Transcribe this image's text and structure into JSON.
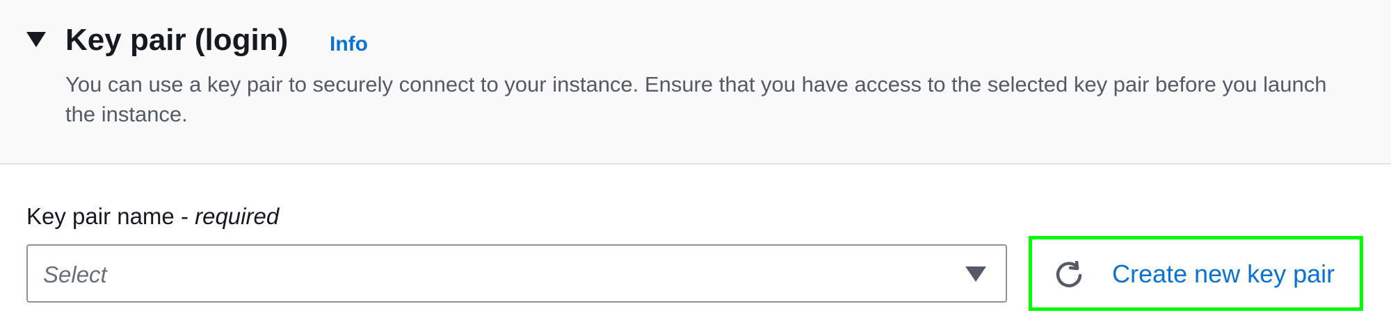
{
  "section": {
    "title": "Key pair (login)",
    "info_link": "Info",
    "description": "You can use a key pair to securely connect to your instance. Ensure that you have access to the selected key pair before you launch the instance.",
    "toggle_icon": "caret-down-icon",
    "expanded": true
  },
  "field": {
    "label": "Key pair name - ",
    "label_required": "required",
    "placeholder": "Select",
    "dropdown_icon": "caret-down-icon"
  },
  "create_button": {
    "label": "Create new key pair",
    "icon": "refresh-icon",
    "highlight_color": "#00ff00"
  },
  "colors": {
    "link": "#0972d3",
    "header_bg": "#f9f9f9",
    "text": "#16191f",
    "muted_text": "#545b64"
  }
}
